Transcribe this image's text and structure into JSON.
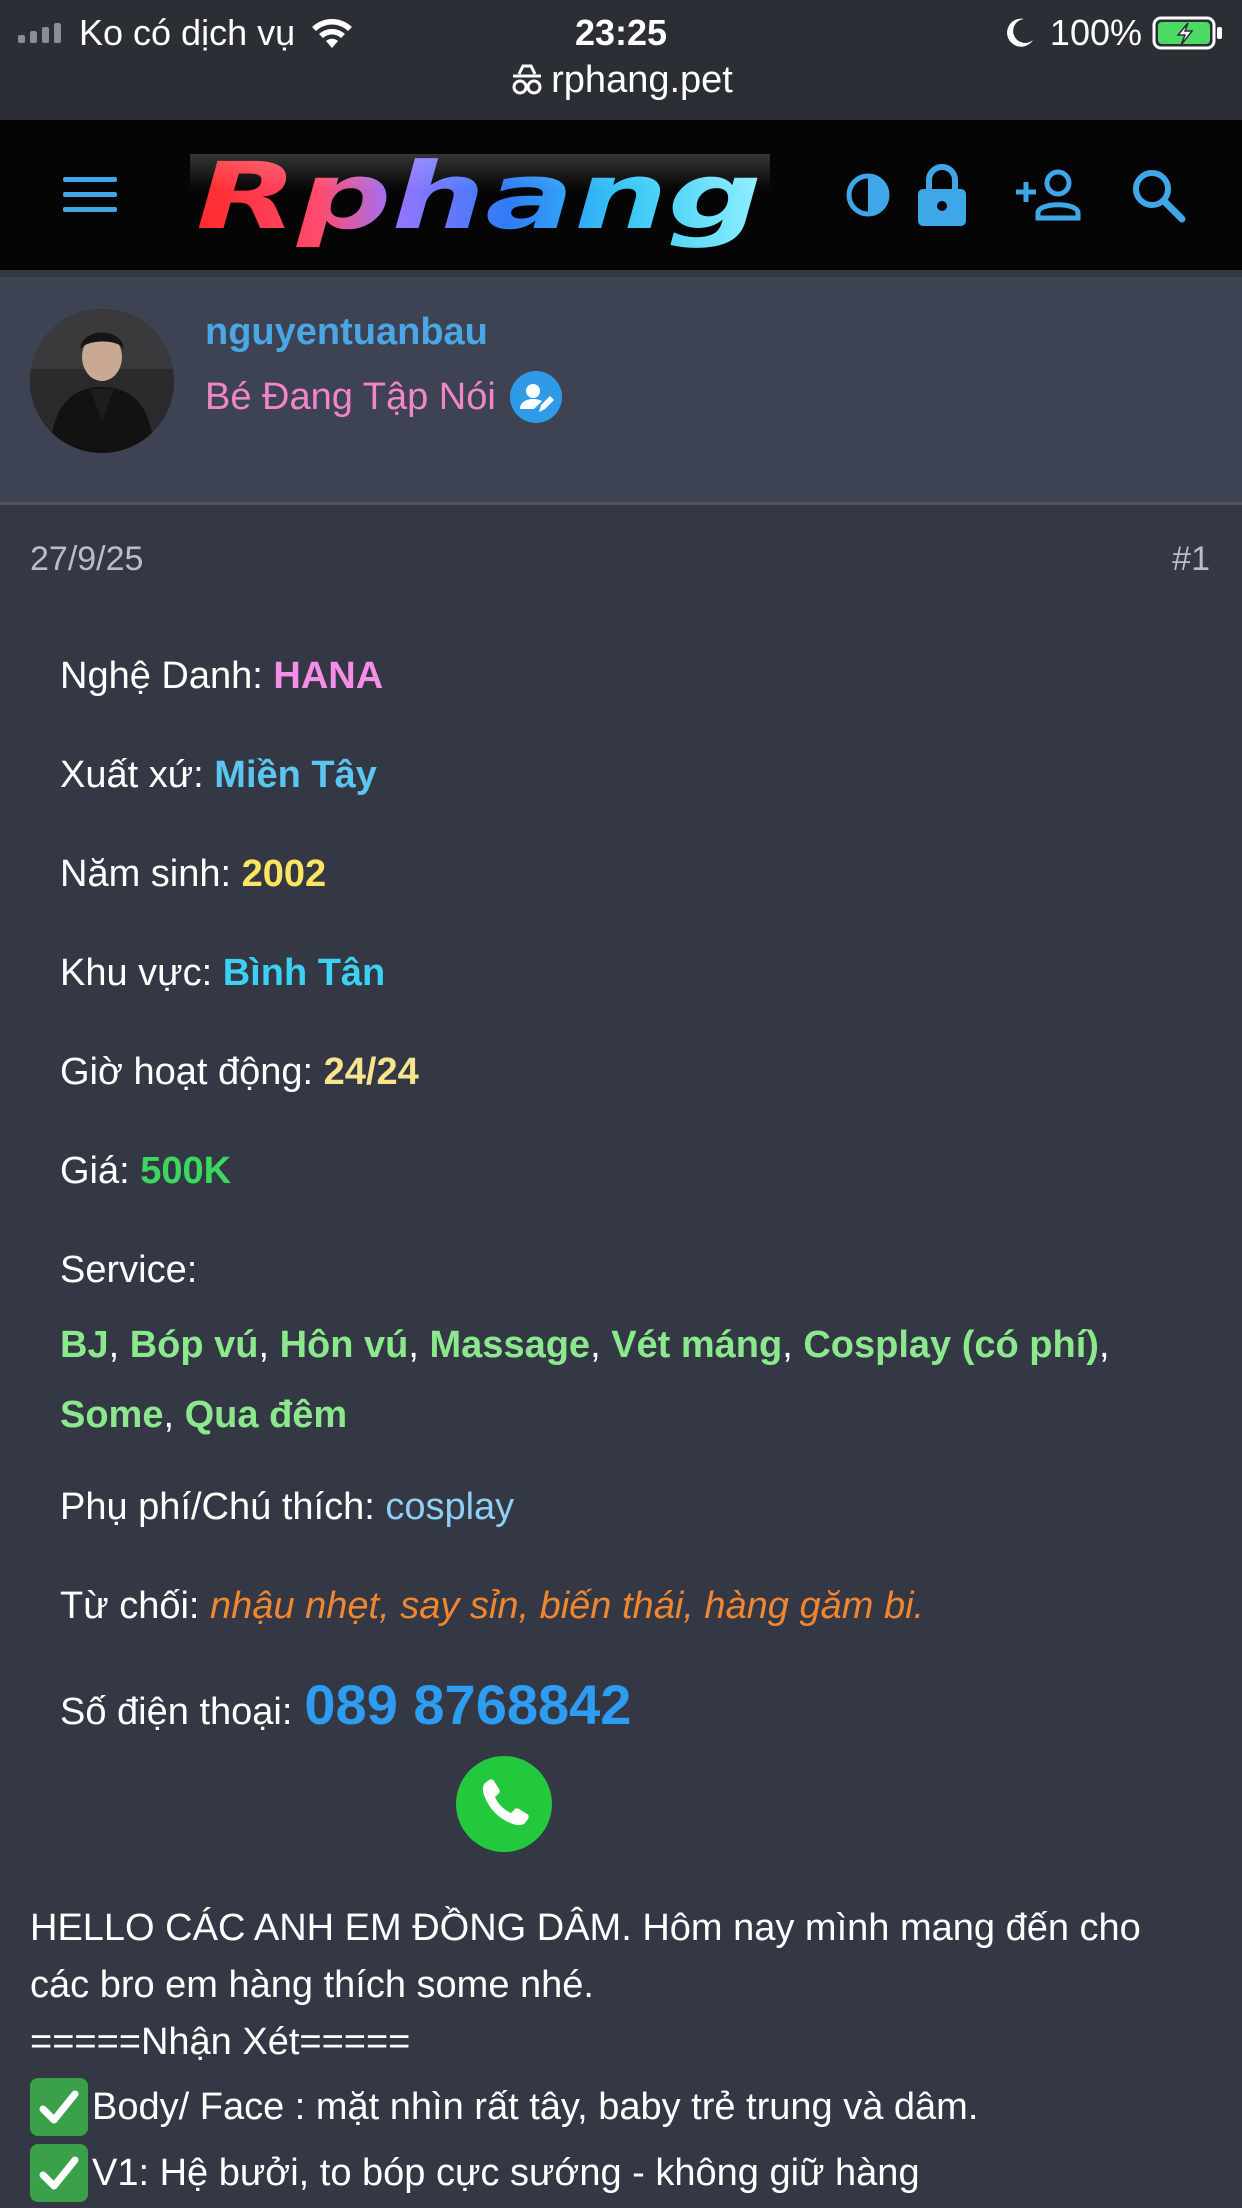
{
  "status_bar": {
    "carrier": "Ko có dịch vụ",
    "time": "23:25",
    "battery": "100%"
  },
  "url_bar": {
    "domain": "rphang.pet"
  },
  "header": {
    "logo_text": "Rphang"
  },
  "user": {
    "name": "nguyentuanbau",
    "title": "Bé Đang Tập Nói"
  },
  "post": {
    "date": "27/9/25",
    "number": "#1",
    "fields": {
      "stage_name_label": "Nghệ Danh:",
      "stage_name": "HANA",
      "origin_label": "Xuất xứ:",
      "origin": "Miền Tây",
      "birth_year_label": "Năm sinh:",
      "birth_year": "2002",
      "area_label": "Khu vực:",
      "area": "Bình Tân",
      "hours_label": "Giờ hoạt động:",
      "hours": "24/24",
      "price_label": "Giá:",
      "price": "500K",
      "service_label": "Service:",
      "services": [
        "BJ",
        "Bóp vú",
        "Hôn vú",
        "Massage",
        "Vét máng",
        "Cosplay (có phí)",
        "Some",
        "Qua đêm"
      ],
      "extra_label": "Phụ phí/Chú thích:",
      "extra": "cosplay",
      "refuse_label": "Từ chối:",
      "refuse": "nhậu nhẹt, say sỉn, biến thái, hàng găm bi.",
      "phone_label": "Số điện thoại:",
      "phone": "089 8768842"
    },
    "intro": "HELLO CÁC ANH EM ĐỒNG DÂM. Hôm nay mình mang đến cho các bro em hàng thích some nhé.",
    "review_header": "=====Nhận Xét=====",
    "reviews": [
      "Body/ Face : mặt nhìn rất tây, baby trẻ trung và dâm.",
      "V1: Hệ bưởi, to bóp cực sướng - không giữ hàng"
    ]
  },
  "colors": {
    "page_bg": "#343844",
    "user_bg": "#3d4353",
    "username": "#4aa6e4",
    "user_title": "#ee86c8",
    "phone": "#2e9cf0"
  }
}
